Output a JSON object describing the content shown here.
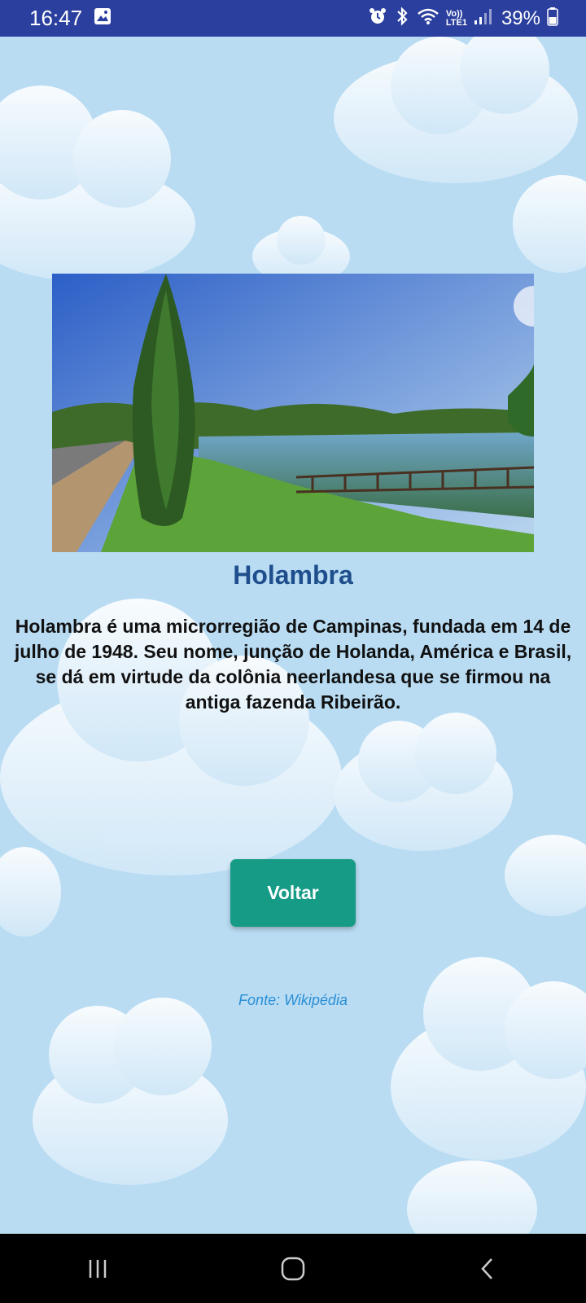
{
  "status_bar": {
    "time": "16:47",
    "gallery_icon": "image-icon",
    "alarm_icon": "alarm-icon",
    "bluetooth_icon": "bluetooth-icon",
    "wifi_icon": "wifi-icon",
    "network_label_top": "Vo))",
    "network_label_bottom": "LTE1",
    "signal_icon": "signal-icon",
    "battery_percent": "39%",
    "battery_icon": "battery-icon"
  },
  "content": {
    "image_description_icon": "landscape-photo",
    "title": "Holambra",
    "description": "Holambra é uma microrregião de Campinas, fundada em 14 de julho de 1948. Seu nome, junção de Holanda, América e Brasil, se dá em virtude da colônia neerlandesa que se firmou na antiga fazenda Ribeirão.",
    "back_button_label": "Voltar",
    "source": "Fonte: Wikipédia"
  },
  "navigation_bar": {
    "recents_icon": "recents-icon",
    "home_icon": "home-icon",
    "back_icon": "back-icon"
  },
  "colors": {
    "status_bar": "#2b3f9e",
    "background": "#b9dcf3",
    "title": "#1e4e8c",
    "button": "#169b86",
    "source_text": "#2a8fd6"
  }
}
